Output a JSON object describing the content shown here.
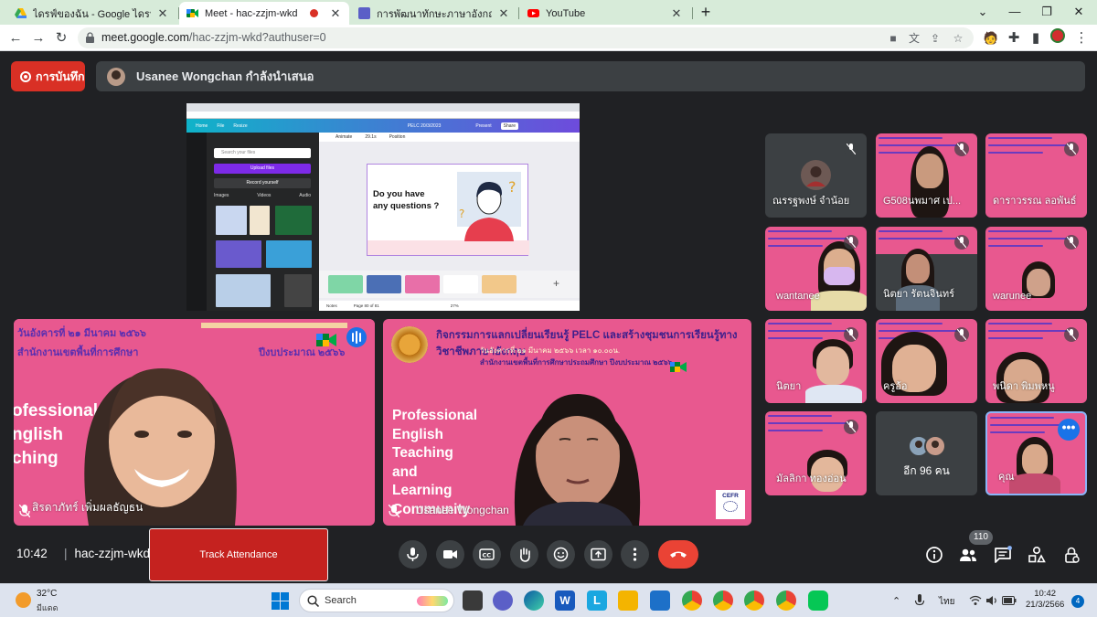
{
  "browser": {
    "tabs": [
      {
        "title": "ไดรฟ์ของฉัน - Google ไดรฟ์",
        "icon": "google-drive-icon"
      },
      {
        "title": "Meet - hac-zzjm-wkd",
        "icon": "google-meet-icon",
        "active": true
      },
      {
        "title": "การพัฒนาทักษะภาษาอังกฤษ English",
        "icon": "google-forms-icon"
      },
      {
        "title": "YouTube",
        "icon": "youtube-icon"
      }
    ],
    "url_host": "meet.google.com",
    "url_path": "/hac-zzjm-wkd?authuser=0"
  },
  "meet": {
    "record_label": "การบันทึก",
    "presenting_text": "Usanee Wongchan กำลังนำเสนอ",
    "shared_screen": {
      "search_placeholder": "Search your files",
      "upload_label": "Upload files",
      "record_label": "Record yourself",
      "tabs": [
        "Images",
        "Videos",
        "Audio"
      ],
      "menu": [
        "Home",
        "File",
        "Resize"
      ],
      "doc_title": "PELC 20/3/2023",
      "present_label": "Present",
      "share_label": "Share",
      "topbar": [
        "Animate",
        "29.1s",
        "Position"
      ],
      "slide_text_line1": "Do you have",
      "slide_text_line2": "any questions ?",
      "footer": [
        "Notes",
        "Page 80 of 81",
        "27%"
      ]
    },
    "tiles": {
      "left": {
        "name": "สิรดาภัทร์ เพิ่มผลธัญธน",
        "headline1": "วันอังคารที่ ๒๑ มีนาคม ๒๕๖๖",
        "headline2": "สำนักงานเขตพื้นที่การศึกษา",
        "budget": "ปีงบประมาณ ๒๕๖๖",
        "big_lines": [
          "ofessional",
          "nglish",
          "ching"
        ]
      },
      "right": {
        "name": "Usanee Wongchan",
        "title1": "กิจกรรมการแลกเปลี่ยนเรียนรู้ PELC และสร้างชุมชนการเรียนรู้ทางวิชาชีพภาษาอังกฤษ",
        "title2": "วันอังคารที่ ๒๑ มีนาคม ๒๕๖๖ เวลา ๑๐.๐๐น.",
        "title3": "สำนักงานเขตพื้นที่การศึกษาประถมศึกษา ปีงบประมาณ ๒๕๖๖",
        "lines": [
          "Professional",
          "English",
          "Teaching",
          "and",
          "Learning",
          "Community"
        ],
        "cefr": "CEFR"
      }
    },
    "participants": [
      {
        "name": "ณรรฐพงษ์ จำน้อย"
      },
      {
        "name": "G508นพมาศ เป..."
      },
      {
        "name": "ดาราวรรณ ลอพันธ์"
      },
      {
        "name": "wantanee"
      },
      {
        "name": "นิตยา รัตนจินทร์"
      },
      {
        "name": "warunee"
      },
      {
        "name": "นิตยา"
      },
      {
        "name": "ครูอ้อ"
      },
      {
        "name": "พนิดา พิมพหนู"
      },
      {
        "name": "มัลลิกา ทองอ่อน"
      },
      {
        "name": "อีก 96 คน"
      },
      {
        "name": "คุณ"
      }
    ],
    "clock": "10:42",
    "meeting_code": "hac-zzjm-wkd",
    "track_attendance": "Track Attendance",
    "participant_count": "110"
  },
  "taskbar": {
    "temperature": "32°C",
    "condition": "มีแดด",
    "search_label": "Search",
    "lang": "ไทย",
    "time": "10:42",
    "date": "21/3/2566",
    "notifications": "4"
  }
}
